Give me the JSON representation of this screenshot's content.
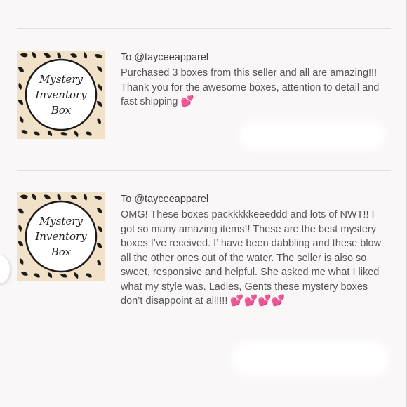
{
  "reviews": [
    {
      "thumb_line1": "Mystery",
      "thumb_line2": "Inventory",
      "thumb_line3": "Box",
      "recipient": "To @tayceeapparel",
      "text": "Purchased 3 boxes from this seller and all are amazing!!! Thank you for the awesome boxes, attention to detail and fast shipping",
      "emoji": "💕"
    },
    {
      "thumb_line1": "Mystery",
      "thumb_line2": "Inventory",
      "thumb_line3": "Box",
      "recipient": "To @tayceeapparel",
      "text": "OMG! These boxes packkkkkeeeddd and lots of NWT!! I got so many amazing items!! These are the best mystery boxes I’ve received. I’ have been dabbling and these blow all the other ones out of the water. The seller is also so sweet, responsive and helpful. She asked me what I liked what my style was. Ladies, Gents these mystery boxes don’t disappoint at all!!!!",
      "emoji": "💕💕💕💕"
    }
  ],
  "colors": {
    "background": "#faf7f9",
    "text": "#555555",
    "heart": "#e85fb3"
  }
}
